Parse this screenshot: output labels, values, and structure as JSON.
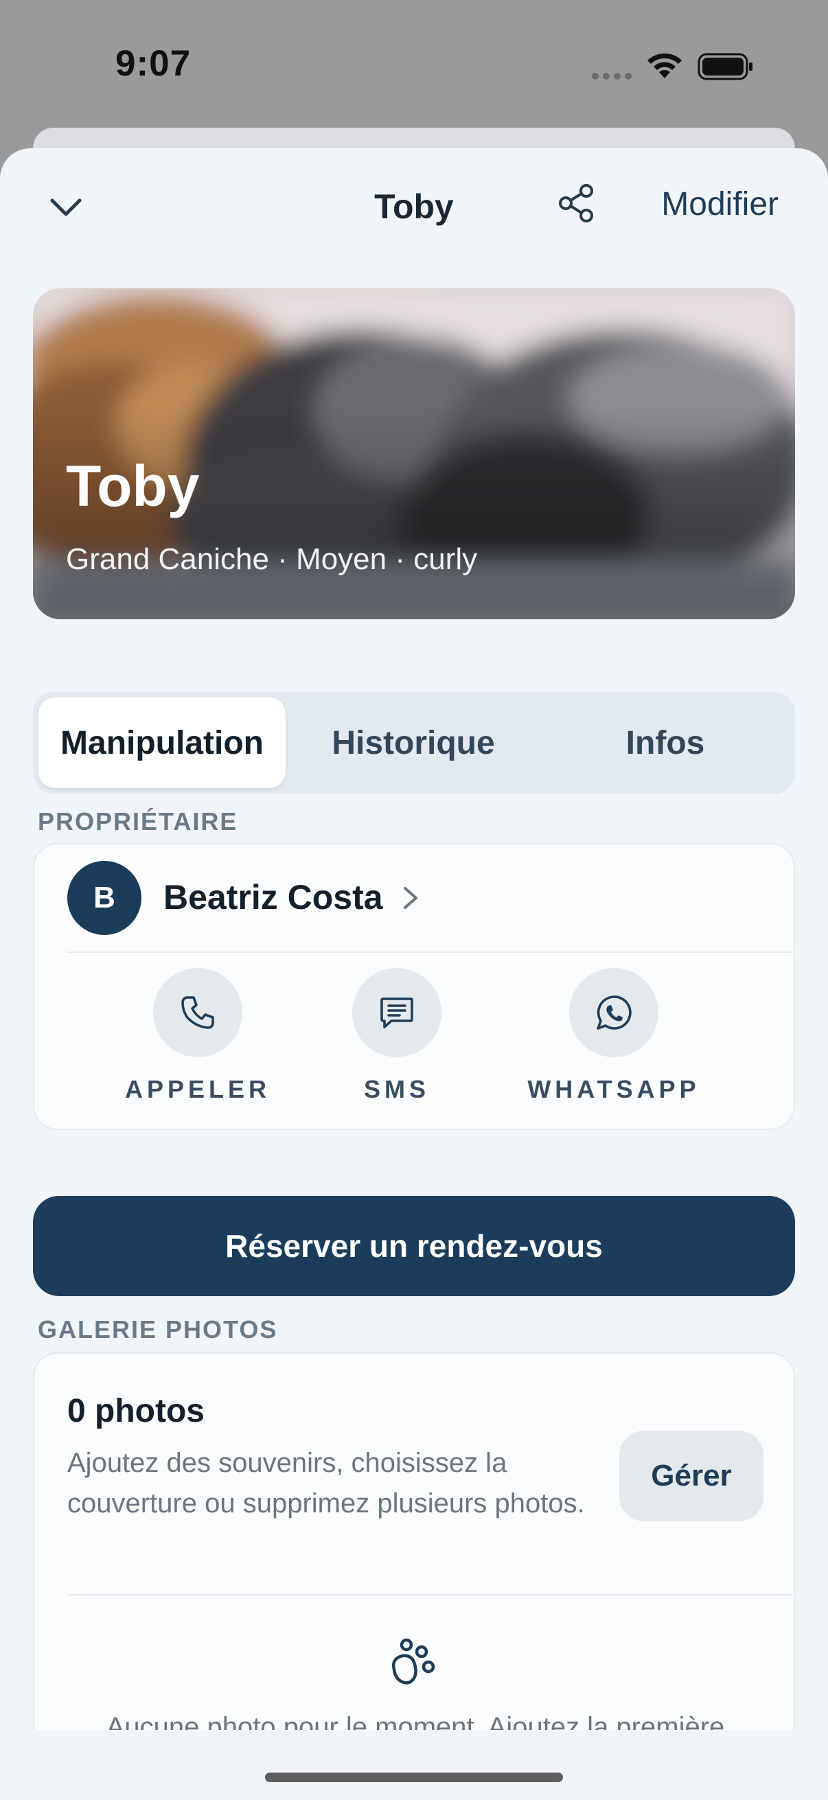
{
  "status_bar": {
    "time": "9:07"
  },
  "nav": {
    "title": "Toby",
    "edit_label": "Modifier"
  },
  "hero": {
    "name": "Toby",
    "subtitle": "Grand Caniche · Moyen · curly"
  },
  "tabs": [
    {
      "label": "Manipulation",
      "active": true
    },
    {
      "label": "Historique",
      "active": false
    },
    {
      "label": "Infos",
      "active": false
    }
  ],
  "owner": {
    "section_label": "PROPRIÉTAIRE",
    "initial": "B",
    "name": "Beatriz Costa",
    "actions": [
      {
        "label": "APPELER",
        "icon": "phone-icon"
      },
      {
        "label": "SMS",
        "icon": "message-icon"
      },
      {
        "label": "WHATSAPP",
        "icon": "whatsapp-icon"
      }
    ]
  },
  "book_button_label": "Réserver un rendez-vous",
  "gallery": {
    "section_label": "GALERIE PHOTOS",
    "count": "0 photos",
    "description": "Ajoutez des souvenirs, choisissez la couverture ou supprimez plusieurs photos.",
    "manage_label": "Gérer",
    "empty_text": "Aucune photo pour le moment. Ajoutez la première"
  },
  "colors": {
    "primary": "#1b3d5b",
    "background": "#f1f4f8",
    "card": "#fbfcfd",
    "muted_text": "#6a7680"
  }
}
